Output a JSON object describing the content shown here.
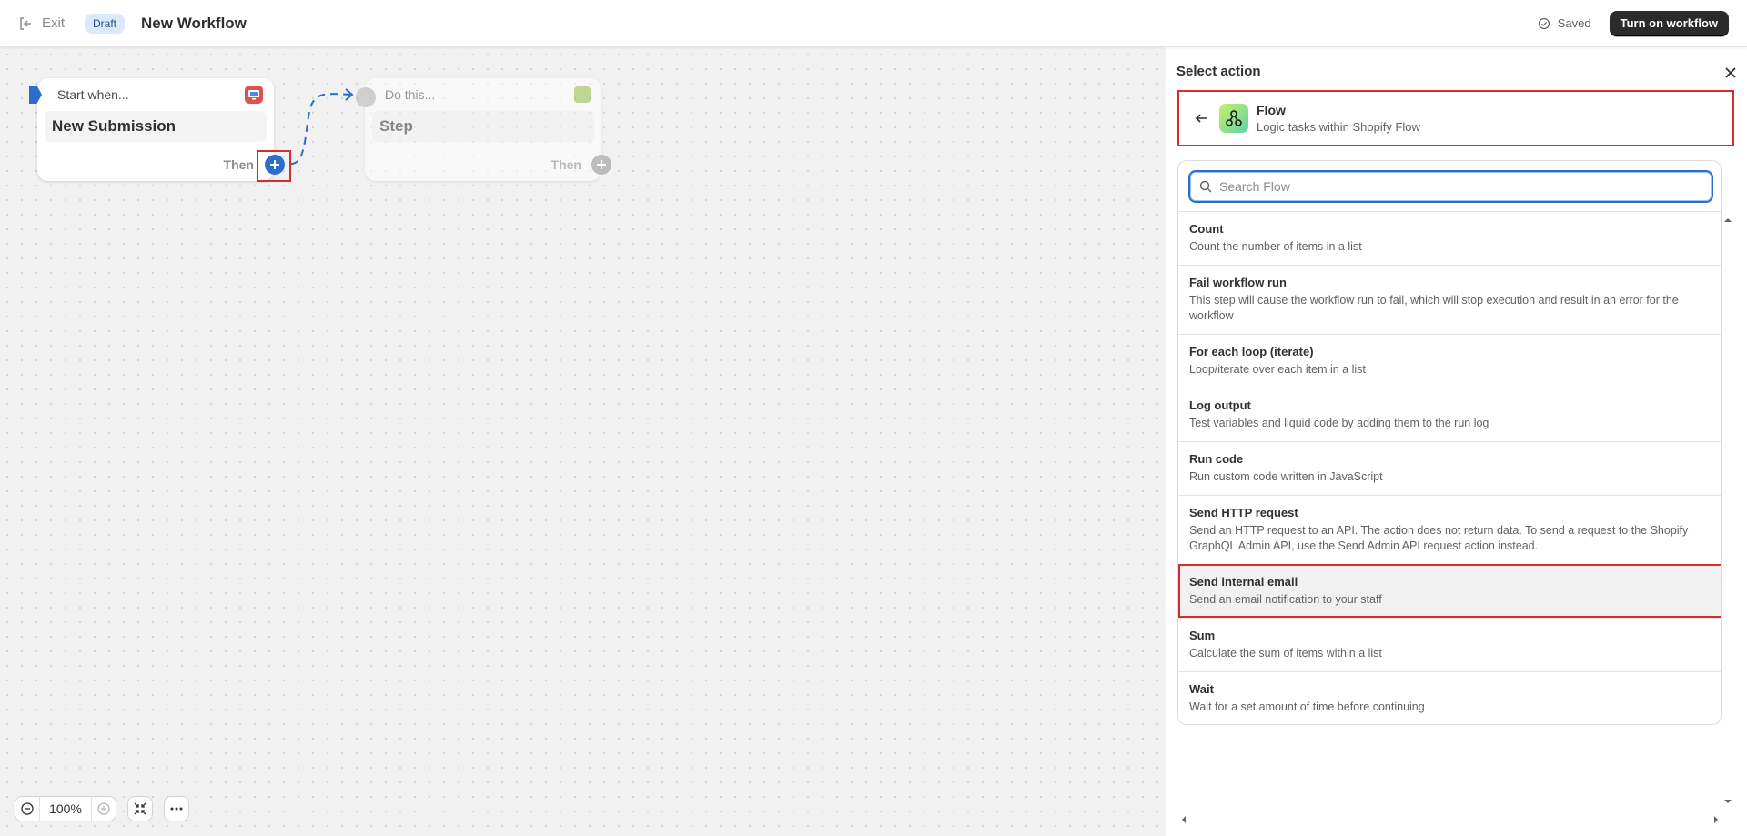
{
  "header": {
    "exit_label": "Exit",
    "draft_badge": "Draft",
    "title": "New Workflow",
    "saved_label": "Saved",
    "turn_on_label": "Turn on workflow"
  },
  "canvas": {
    "start_node": {
      "heading": "Start when...",
      "trigger": "New Submission",
      "then_label": "Then",
      "app_icon": "monitor-app-icon"
    },
    "do_node": {
      "heading": "Do this...",
      "step": "Step",
      "then_label": "Then",
      "app_icon": "shopify-bag-icon"
    },
    "zoom": {
      "value": "100%"
    }
  },
  "panel": {
    "title": "Select action",
    "app": {
      "name": "Flow",
      "description": "Logic tasks within Shopify Flow"
    },
    "search": {
      "placeholder": "Search Flow",
      "value": ""
    },
    "actions": [
      {
        "name": "Count",
        "description": "Count the number of items in a list"
      },
      {
        "name": "Fail workflow run",
        "description": "This step will cause the workflow run to fail, which will stop execution and result in an error for the workflow"
      },
      {
        "name": "For each loop (iterate)",
        "description": "Loop/iterate over each item in a list"
      },
      {
        "name": "Log output",
        "description": "Test variables and liquid code by adding them to the run log"
      },
      {
        "name": "Run code",
        "description": "Run custom code written in JavaScript"
      },
      {
        "name": "Send HTTP request",
        "description": "Send an HTTP request to an API. The action does not return data. To send a request to the Shopify GraphQL Admin API, use the Send Admin API request action instead."
      },
      {
        "name": "Send internal email",
        "description": "Send an email notification to your staff"
      },
      {
        "name": "Sum",
        "description": "Calculate the sum of items within a list"
      },
      {
        "name": "Wait",
        "description": "Wait for a set amount of time before continuing"
      }
    ],
    "selected_action": "Send internal email"
  },
  "colors": {
    "accent": "#2c6ecb",
    "highlight": "#d72c2c",
    "primary_button": "#2b2b2b"
  }
}
